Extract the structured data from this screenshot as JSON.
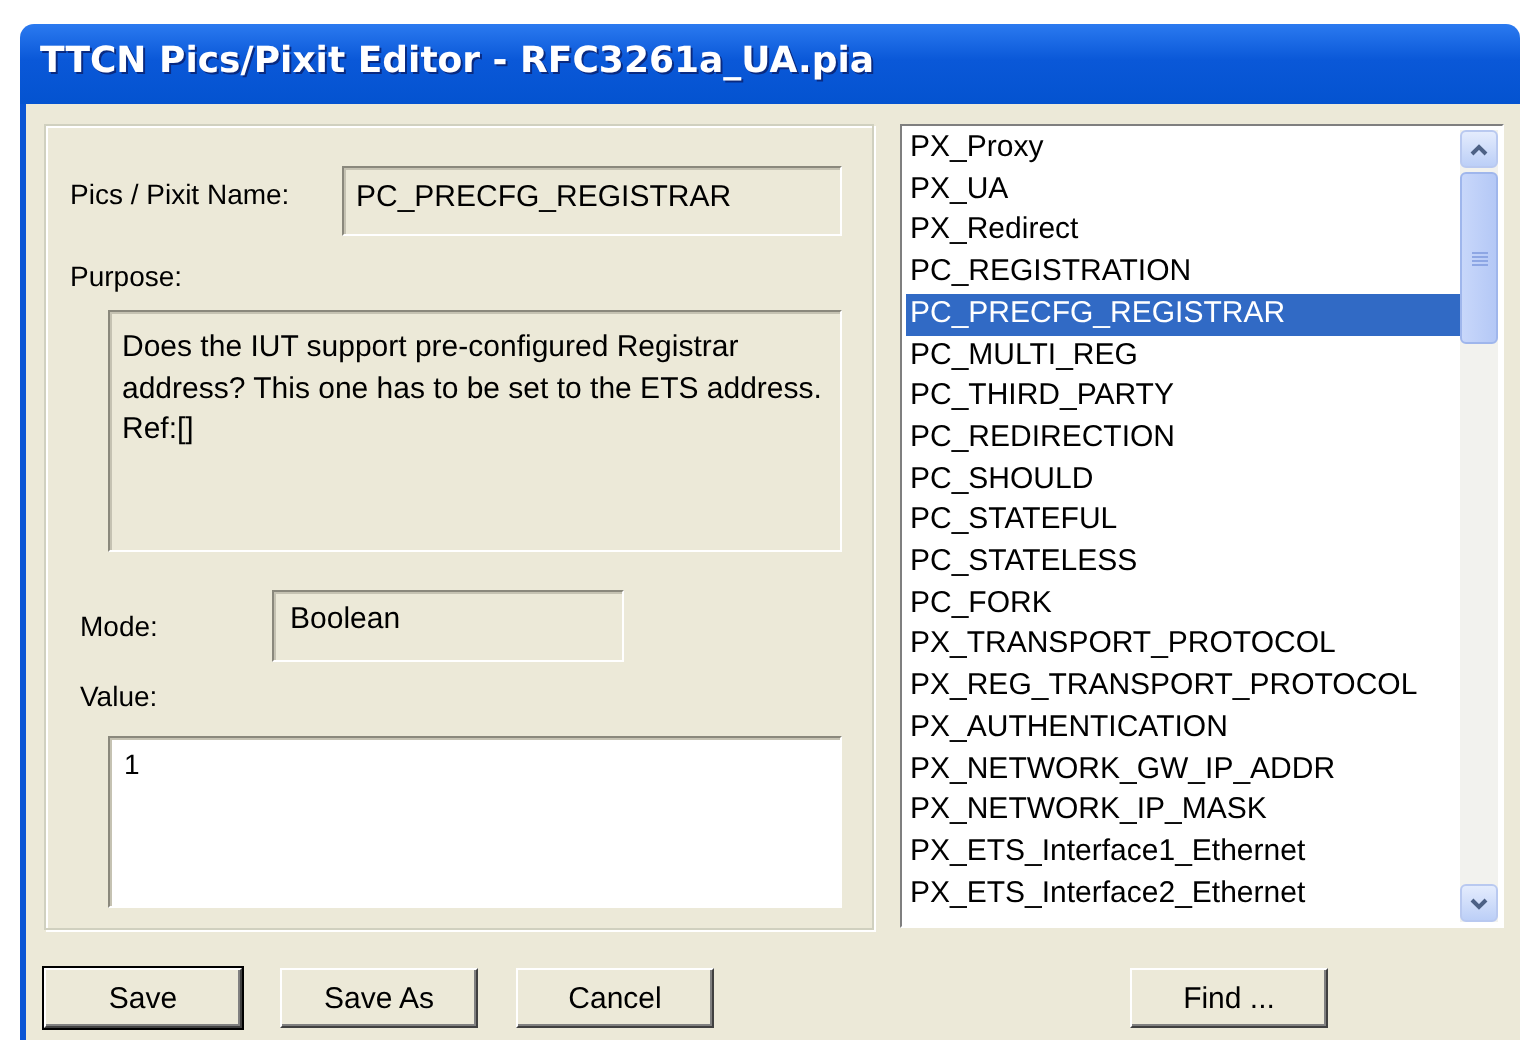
{
  "window": {
    "title": "TTCN Pics/Pixit Editor - RFC3261a_UA.pia"
  },
  "form": {
    "name_label": "Pics / Pixit Name:",
    "name_value": "PC_PRECFG_REGISTRAR",
    "purpose_label": "Purpose:",
    "purpose": "Does the IUT support pre-configured Registrar address? This one has to be set to the ETS address.  Ref:[]",
    "mode_label": "Mode:",
    "mode": "Boolean",
    "value_label": "Value:",
    "value": "1"
  },
  "list": {
    "items": [
      {
        "label": "PX_Proxy",
        "selected": false
      },
      {
        "label": "PX_UA",
        "selected": false
      },
      {
        "label": "PX_Redirect",
        "selected": false
      },
      {
        "label": "PC_REGISTRATION",
        "selected": false
      },
      {
        "label": "PC_PRECFG_REGISTRAR",
        "selected": true
      },
      {
        "label": "PC_MULTI_REG",
        "selected": false
      },
      {
        "label": "PC_THIRD_PARTY",
        "selected": false
      },
      {
        "label": "PC_REDIRECTION",
        "selected": false
      },
      {
        "label": "PC_SHOULD",
        "selected": false
      },
      {
        "label": "PC_STATEFUL",
        "selected": false
      },
      {
        "label": "PC_STATELESS",
        "selected": false
      },
      {
        "label": "PC_FORK",
        "selected": false
      },
      {
        "label": "PX_TRANSPORT_PROTOCOL",
        "selected": false
      },
      {
        "label": "PX_REG_TRANSPORT_PROTOCOL",
        "selected": false
      },
      {
        "label": "PX_AUTHENTICATION",
        "selected": false
      },
      {
        "label": "PX_NETWORK_GW_IP_ADDR",
        "selected": false
      },
      {
        "label": "PX_NETWORK_IP_MASK",
        "selected": false
      },
      {
        "label": "PX_ETS_Interface1_Ethernet",
        "selected": false
      },
      {
        "label": "PX_ETS_Interface2_Ethernet",
        "selected": false
      }
    ]
  },
  "buttons": [
    {
      "label": "Save",
      "default": true
    },
    {
      "label": "Save As",
      "default": false
    },
    {
      "label": "Cancel",
      "default": false
    }
  ],
  "find_button": {
    "label": "Find ..."
  }
}
